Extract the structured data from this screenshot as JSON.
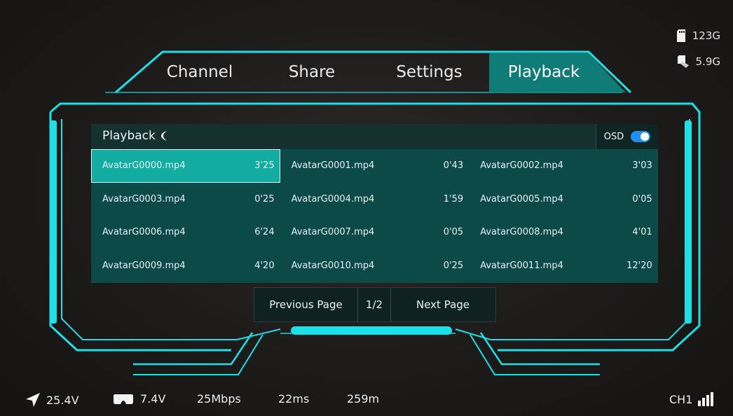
{
  "tabs": [
    {
      "label": "Channel"
    },
    {
      "label": "Share"
    },
    {
      "label": "Settings"
    },
    {
      "label": "Playback"
    }
  ],
  "active_tab": "Playback",
  "storage": {
    "sd_card": "123G",
    "internal": "5.9G"
  },
  "panel": {
    "title": "Playback",
    "osd_label": "OSD",
    "osd_enabled": true
  },
  "files": [
    {
      "name": "AvatarG0000.mp4",
      "duration": "3'25"
    },
    {
      "name": "AvatarG0001.mp4",
      "duration": "0'43"
    },
    {
      "name": "AvatarG0002.mp4",
      "duration": "3'03"
    },
    {
      "name": "AvatarG0003.mp4",
      "duration": "0'25"
    },
    {
      "name": "AvatarG0004.mp4",
      "duration": "1'59"
    },
    {
      "name": "AvatarG0005.mp4",
      "duration": "0'05"
    },
    {
      "name": "AvatarG0006.mp4",
      "duration": "6'24"
    },
    {
      "name": "AvatarG0007.mp4",
      "duration": "0'05"
    },
    {
      "name": "AvatarG0008.mp4",
      "duration": "4'01"
    },
    {
      "name": "AvatarG0009.mp4",
      "duration": "4'20"
    },
    {
      "name": "AvatarG0010.mp4",
      "duration": "0'25"
    },
    {
      "name": "AvatarG0011.mp4",
      "duration": "12'20"
    }
  ],
  "selected_file": "AvatarG0000.mp4",
  "pager": {
    "prev_label": "Previous Page",
    "page": "1/2",
    "next_label": "Next Page"
  },
  "status": {
    "air_voltage": "25.4V",
    "goggle_voltage": "7.4V",
    "bitrate": "25Mbps",
    "latency": "22ms",
    "distance": "259m",
    "channel": "CH1"
  },
  "colors": {
    "accent": "#1ce0e6",
    "panel": "#0c4a47",
    "selected": "#13aca2",
    "toggle": "#1f8ff0"
  },
  "icons": {
    "flight": "navigation-arrow-icon",
    "goggles": "goggles-icon",
    "sd": "sd-card-icon",
    "storage": "storage-icon",
    "signal": "signal-bars-icon"
  }
}
